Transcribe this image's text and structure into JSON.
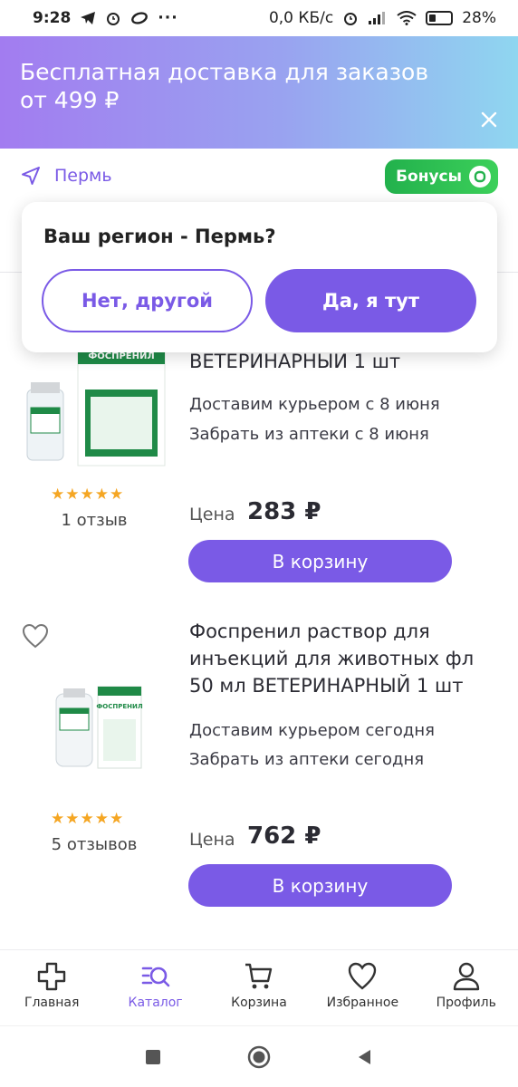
{
  "status_bar": {
    "time": "9:28",
    "speed": "0,0 КБ/с",
    "battery": "28%"
  },
  "banner": {
    "text": "Бесплатная доставка для заказов от 499 ₽"
  },
  "location": {
    "city": "Пермь"
  },
  "bonus": {
    "label": "Бонусы"
  },
  "region_popup": {
    "title": "Ваш регион - Пермь?",
    "no_label": "Нет, другой",
    "yes_label": "Да, я тут"
  },
  "products": [
    {
      "title": "ВЕТЕРИНАРНЫЙ 1 шт",
      "delivery": "Доставим курьером с 8 июня",
      "pickup": "Забрать из аптеки с 8 июня",
      "price_label": "Цена",
      "price": "283 ₽",
      "rating": 5,
      "reviews": "1 отзыв",
      "cart_label": "В корзину",
      "image_text": "ФОСПРЕНИЛ"
    },
    {
      "title": "Фоспренил раствор для инъекций для животных фл 50 мл ВЕТЕРИНАРНЫЙ 1 шт",
      "delivery": "Доставим курьером сегодня",
      "pickup": "Забрать из аптеки сегодня",
      "price_label": "Цена",
      "price": "762 ₽",
      "rating": 5,
      "reviews": "5 отзывов",
      "cart_label": "В корзину",
      "image_text": "ФОСПРЕНИЛ"
    }
  ],
  "bottom_nav": [
    {
      "label": "Главная",
      "icon": "plus-cross-icon",
      "active": false
    },
    {
      "label": "Каталог",
      "icon": "catalog-search-icon",
      "active": true
    },
    {
      "label": "Корзина",
      "icon": "cart-icon",
      "active": false
    },
    {
      "label": "Избранное",
      "icon": "heart-icon",
      "active": false
    },
    {
      "label": "Профиль",
      "icon": "profile-icon",
      "active": false
    }
  ],
  "colors": {
    "accent": "#7a5ae6",
    "bonus_green": "#22b14c",
    "star": "#f5a623"
  }
}
